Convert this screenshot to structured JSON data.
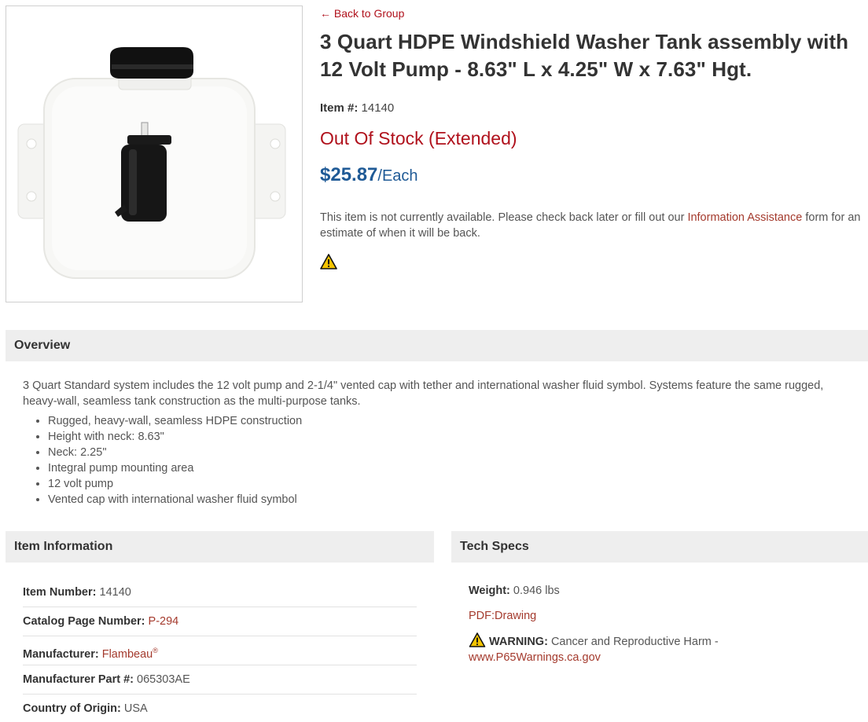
{
  "product": {
    "image_alt": "3 Quart HDPE windshield washer tank with black cap and 12 volt pump",
    "back_link": "← Back to Group",
    "title": "3 Quart HDPE Windshield Washer Tank assembly with 12 Volt Pump - 8.63\" L x 4.25\" W x 7.63\" Hgt.",
    "item_label": "Item #:",
    "item_number": "14140",
    "stock_status": "Out Of Stock (Extended)",
    "price": "$25.87",
    "price_unit": "/Each",
    "notice_prefix": "This item is not currently available. Please check back later or fill out our",
    "notice_link": "Information Assistance",
    "notice_suffix": "form for an estimate of when it will be back."
  },
  "overview": {
    "heading": "Overview",
    "description": "3 Quart Standard system includes the 12 volt pump and 2-1/4\" vented cap with tether and international washer fluid symbol. Systems feature the same rugged, heavy-wall, seamless tank construction as the multi-purpose tanks.",
    "bullets": [
      "Rugged, heavy-wall, seamless HDPE construction",
      "Height with neck: 8.63\"",
      "Neck: 2.25\"",
      "Integral pump mounting area",
      "12 volt pump",
      "Vented cap with international washer fluid symbol"
    ]
  },
  "item_information": {
    "heading": "Item Information",
    "rows": [
      {
        "label": "Item Number:",
        "value": "14140"
      },
      {
        "label": "Catalog Page Number:",
        "value": "P-294"
      },
      {
        "label": "Manufacturer:",
        "value": "Flambeau",
        "mark": "®"
      },
      {
        "label": "Manufacturer Part #:",
        "value": "065303AE"
      },
      {
        "label": "Country of Origin:",
        "value": "USA"
      }
    ]
  },
  "tech_specs": {
    "heading": "Tech Specs",
    "weight_label": "Weight:",
    "weight_value": "0.946 lbs",
    "pdf_link": "PDF:Drawing",
    "warning_label": "WARNING:",
    "warning_text": "Cancer and Reproductive Harm -",
    "warning_link": "www.P65Warnings.ca.gov"
  },
  "colors": {
    "accent_red": "#b0111c",
    "price_blue": "#1f5a96",
    "link_brown": "#a43a2d",
    "section_bg": "#eeeeee"
  },
  "icons": [
    "warning-triangle-icon"
  ]
}
